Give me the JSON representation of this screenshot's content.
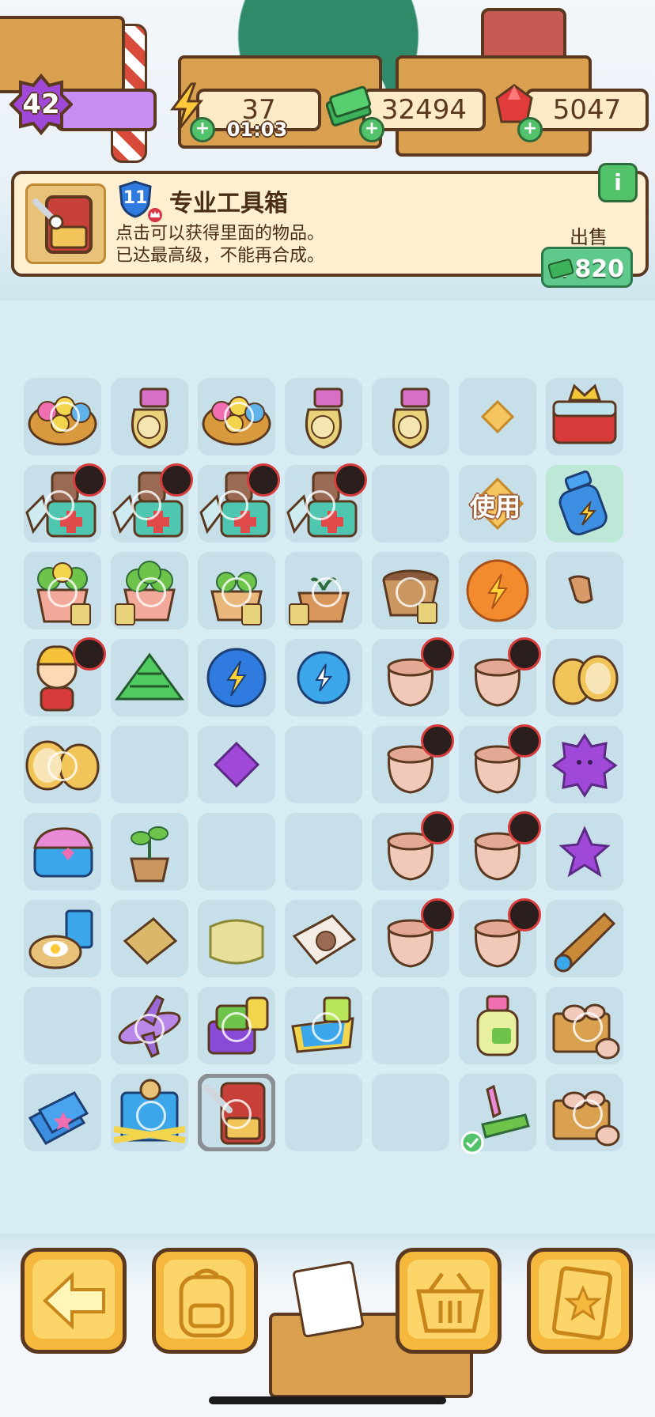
{
  "hud": {
    "level": "42",
    "energy": "37",
    "energy_timer": "01:03",
    "cash": "32494",
    "gems": "5047"
  },
  "info": {
    "item_level": "11",
    "title": "专业工具箱",
    "desc_line1": "点击可以获得里面的物品。",
    "desc_line2": "已达最高级，不能再合成。",
    "sell_label": "出售",
    "sell_value": "+820",
    "info_icon": "i"
  },
  "board": {
    "use_label": "使用"
  },
  "icons": {
    "level": "purple-star-icon",
    "energy": "lightning-icon",
    "cash": "cash-stack-icon",
    "gems": "ruby-icon"
  },
  "colors": {
    "accent_green": "#52c26b",
    "panel": "#fdefd0",
    "outline": "#5b3920",
    "level_purple": "#c98cf3",
    "button_orange": "#f5b83c"
  }
}
